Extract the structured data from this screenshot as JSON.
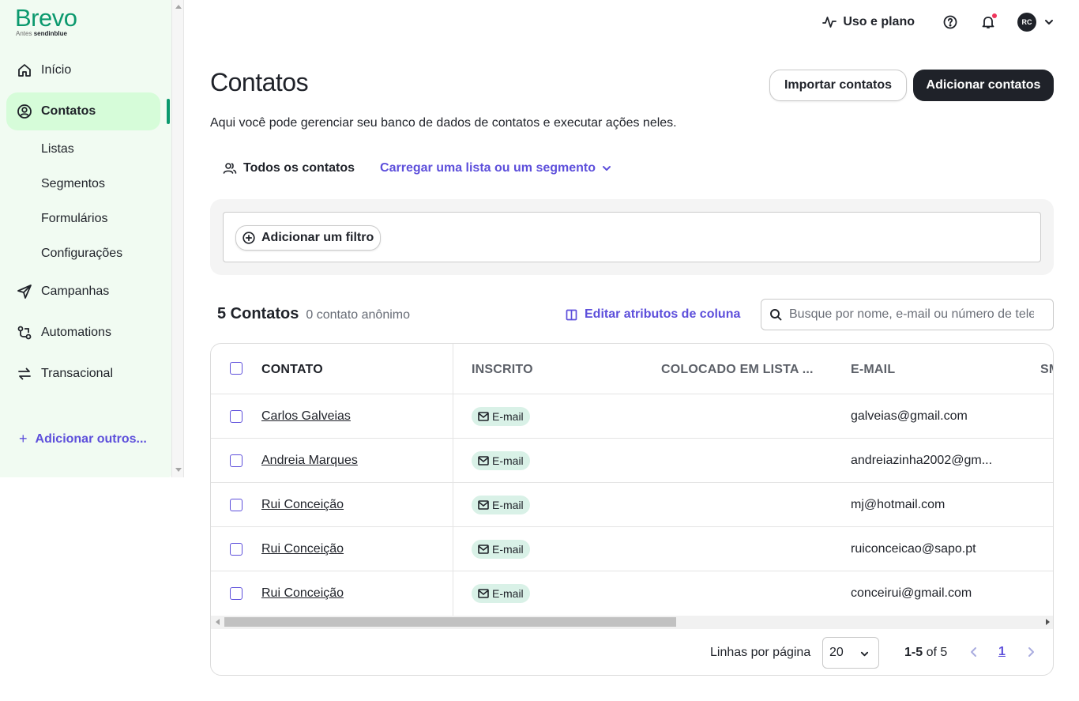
{
  "brand": {
    "name": "Brevo",
    "sub_prefix": "Antes",
    "sub_brand": "sendinblue"
  },
  "sidebar": {
    "items": [
      {
        "label": "Início",
        "icon": "home-icon"
      },
      {
        "label": "Contatos",
        "icon": "contacts-icon",
        "active": true
      },
      {
        "label": "Campanhas",
        "icon": "send-icon"
      },
      {
        "label": "Automations",
        "icon": "automation-icon"
      },
      {
        "label": "Transacional",
        "icon": "transactional-icon"
      }
    ],
    "sub_items": [
      "Listas",
      "Segmentos",
      "Formulários",
      "Configurações"
    ],
    "add_more": "Adicionar outros..."
  },
  "header": {
    "usage_label": "Uso e plano",
    "avatar_initials": "RC"
  },
  "page": {
    "title": "Contatos",
    "description": "Aqui você pode gerenciar seu banco de dados de contatos e executar ações neles.",
    "import_button": "Importar contatos",
    "add_button": "Adicionar contatos",
    "all_contacts": "Todos os contatos",
    "load_list": "Carregar uma lista ou um segmento",
    "add_filter": "Adicionar um filtro",
    "count_main": "5 Contatos",
    "count_sub": "0 contato anônimo",
    "edit_columns": "Editar atributos de coluna",
    "search_placeholder": "Busque por nome, e-mail ou número de telefone"
  },
  "table": {
    "columns": [
      "CONTATO",
      "INSCRITO",
      "COLOCADO EM LISTA ...",
      "E-MAIL",
      "SMS"
    ],
    "rows": [
      {
        "name": "Carlos Galveias",
        "subscribed": "E-mail",
        "email": "galveias@gmail.com"
      },
      {
        "name": "Andreia Marques",
        "subscribed": "E-mail",
        "email": "andreiazinha2002@gm..."
      },
      {
        "name": "Rui Conceição",
        "subscribed": "E-mail",
        "email": "mj@hotmail.com"
      },
      {
        "name": "Rui Conceição",
        "subscribed": "E-mail",
        "email": "ruiconceicao@sapo.pt"
      },
      {
        "name": "Rui Conceição",
        "subscribed": "E-mail",
        "email": "conceirui@gmail.com"
      }
    ]
  },
  "pagination": {
    "rows_label": "Linhas por página",
    "rows_value": "20",
    "range_bold": "1-5",
    "range_rest": " of 5",
    "current_page": "1"
  },
  "colors": {
    "accent": "#5d4fdb",
    "brand_green": "#0b996e",
    "active_bg": "#d6fcd9",
    "dark": "#1f2229"
  }
}
